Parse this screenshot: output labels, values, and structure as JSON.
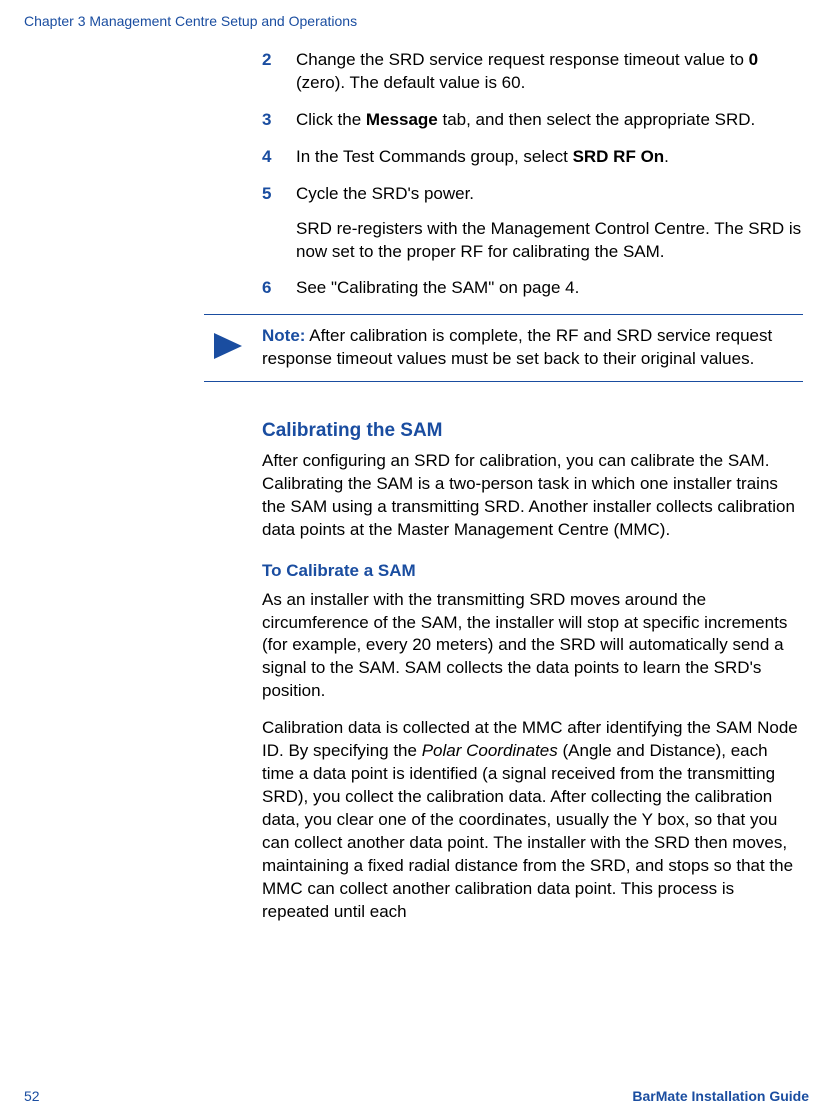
{
  "header": {
    "chapter": "Chapter 3 Management Centre Setup and Operations"
  },
  "steps": {
    "s2": {
      "num": "2",
      "pre": "Change the SRD service request response timeout value to ",
      "bold": "0",
      "post": " (zero). The default value is 60."
    },
    "s3": {
      "num": "3",
      "pre": "Click the ",
      "bold": "Message",
      "post": " tab, and then select the appropriate SRD."
    },
    "s4": {
      "num": "4",
      "pre": "In the Test Commands group, select ",
      "bold": "SRD RF On",
      "post": "."
    },
    "s5": {
      "num": "5",
      "line1": "Cycle the SRD's power.",
      "line2": "SRD re-registers with the Management Control Centre. The SRD is now set to the proper RF for calibrating the SAM."
    },
    "s6": {
      "num": "6",
      "text": "See \"Calibrating the SAM\" on page 4."
    }
  },
  "note": {
    "label": "Note:",
    "text": " After calibration is complete, the RF and SRD service request response timeout values must be set back to their original values."
  },
  "section": {
    "heading": "Calibrating the SAM",
    "intro": "After configuring an SRD for calibration, you can calibrate the SAM.  Calibrating the SAM is a two-person task in which one installer trains the SAM using a transmitting SRD.  Another installer collects calibration data points at the Master Management Centre (MMC).",
    "subheading": "To Calibrate a SAM",
    "p1": "As an installer with the transmitting SRD moves around the circumference of the SAM, the installer will stop at specific increments (for example, every 20 meters) and the SRD will automatically send a signal to the SAM.  SAM collects the data points to learn the SRD's position.",
    "p2_pre": "Calibration data is collected at the MMC after identifying the SAM Node ID. By specifying the ",
    "p2_ital": "Polar Coordinates",
    "p2_post": " (Angle and Distance), each time a data point is identified (a signal received from the transmitting SRD), you collect the calibration data. After collecting the calibration data, you clear one of the coordinates, usually the Y box, so that you can collect another data point. The installer with the SRD then moves, maintaining a fixed radial distance from the SRD, and stops so that the MMC can collect another calibration data point. This process is repeated until each"
  },
  "footer": {
    "page": "52",
    "guide": "BarMate Installation Guide"
  }
}
